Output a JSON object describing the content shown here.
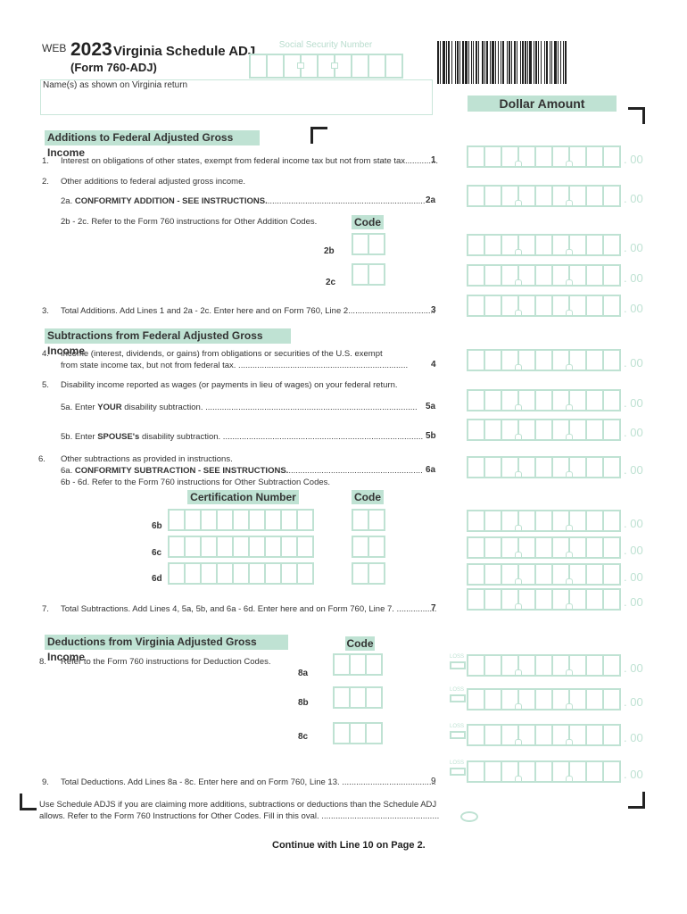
{
  "header": {
    "web": "WEB",
    "year": "2023",
    "title": "Virginia Schedule ADJ",
    "form": "(Form 760-ADJ)",
    "ssn_label": "Social Security Number",
    "name_label": "Name(s) as shown on Virginia return",
    "dollar_amount": "Dollar Amount"
  },
  "additions": {
    "title": "Additions to Federal Adjusted Gross Income",
    "line1_num": "1.",
    "line1_text": "Interest on obligations of other states, exempt from federal income tax but not from state tax..............",
    "line1_ref": "1",
    "line2_num": "2.",
    "line2_text": "Other additions to federal adjusted gross income.",
    "line2a_prefix": "2a. ",
    "line2a_bold": "CONFORMITY ADDITION - SEE INSTRUCTIONS.",
    "line2a_dots": "...................................................................",
    "line2a_ref": "2a",
    "line2bc_text": "2b - 2c. Refer to the Form 760 instructions for Other Addition Codes.",
    "code_label": "Code",
    "line2b_ref": "2b",
    "line2c_ref": "2c",
    "line3_num": "3.",
    "line3_text": "Total Additions. Add Lines 1 and 2a - 2c. Enter here and on Form 760, Line 2.....................................",
    "line3_ref": "3"
  },
  "subtractions": {
    "title": "Subtractions from Federal Adjusted Gross Income",
    "line4_num": "4.",
    "line4_text1": "Income (interest, dividends, or gains) from obligations or securities of the U.S. exempt",
    "line4_text2": "from state income tax, but not from federal tax. ........................................................................",
    "line4_ref": "4",
    "line5_num": "5.",
    "line5_text": "Disability income reported as wages (or payments in lieu of wages) on your federal return.",
    "line5a_prefix": "5a. Enter ",
    "line5a_bold": "YOUR",
    "line5a_suffix": " disability subtraction. ..........................................................................................",
    "line5a_ref": "5a",
    "line5b_prefix": "5b. Enter ",
    "line5b_bold": "SPOUSE's",
    "line5b_suffix": " disability subtraction. .....................................................................................",
    "line5b_ref": "5b",
    "line6_num": "6.",
    "line6_text": "Other subtractions as provided in instructions.",
    "line6a_prefix": "6a. ",
    "line6a_bold": "CONFORMITY SUBTRACTION - SEE INSTRUCTIONS.",
    "line6a_dots": ".........................................................",
    "line6a_ref": "6a",
    "line6bd_text": "6b - 6d. Refer to the Form 760 instructions for Other Subtraction Codes.",
    "cert_label": "Certification Number",
    "code_label": "Code",
    "line6b_ref": "6b",
    "line6c_ref": "6c",
    "line6d_ref": "6d",
    "line7_num": "7.",
    "line7_text": "Total Subtractions. Add Lines 4, 5a, 5b, and 6a - 6d. Enter here and on Form 760, Line 7. .................",
    "line7_ref": "7"
  },
  "deductions": {
    "title": "Deductions from Virginia Adjusted Gross Income",
    "code_label": "Code",
    "line8_num": "8.",
    "line8_text": "Refer to the Form 760 instructions for Deduction Codes.",
    "line8a_ref": "8a",
    "line8b_ref": "8b",
    "line8c_ref": "8c",
    "loss_label": "LOSS",
    "line9_num": "9.",
    "line9_text": "Total Deductions. Add Lines 8a - 8c. Enter here and on Form 760, Line 13. ........................................",
    "line9_ref": "9"
  },
  "footer": {
    "adjs_text1": "Use Schedule ADJS if you are claiming more additions, subtractions or deductions than the Schedule ADJ",
    "adjs_text2": "allows. Refer to the Form 760 Instructions for Other Codes. Fill in this oval. ..................................................",
    "continue": "Continue with Line 10 on Page 2."
  },
  "money": {
    "cents": ". 00"
  },
  "colors": {
    "accent": "#bfe2d3",
    "text": "#2b2b2b"
  }
}
